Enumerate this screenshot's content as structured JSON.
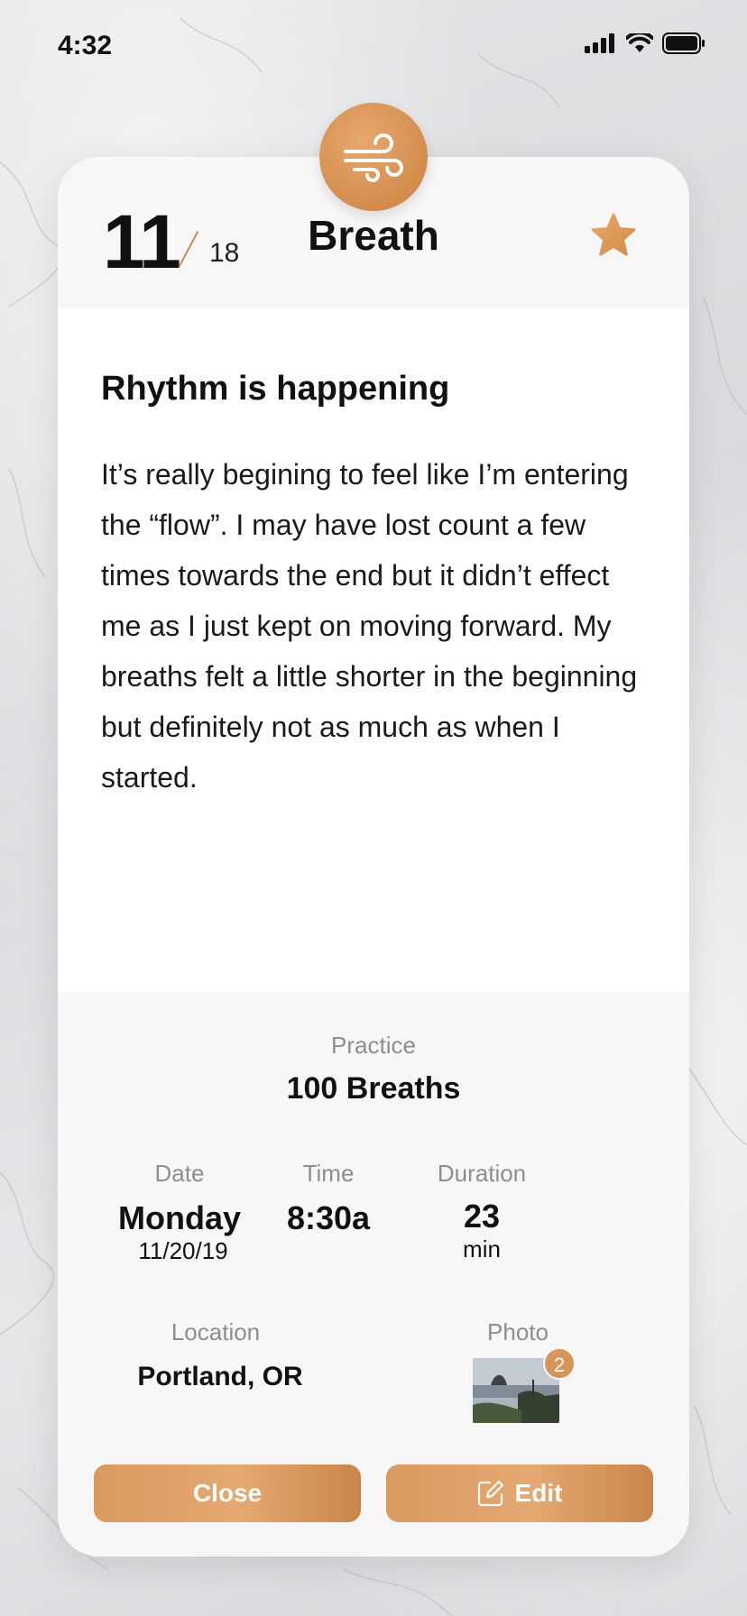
{
  "status_bar": {
    "time": "4:32"
  },
  "header": {
    "day": "11",
    "total": "18",
    "title": "Breath"
  },
  "entry": {
    "title": "Rhythm is happening",
    "body": "It’s really begining to feel like I’m entering the “flow”. I may have lost count a few times towards the end but it didn’t effect me as I just kept on moving forward. My breaths felt a little shorter in the beginning but definitely not as much as when I started."
  },
  "details": {
    "practice_label": "Practice",
    "practice_value": "100 Breaths",
    "date_label": "Date",
    "date_day": "Monday",
    "date_value": "11/20/19",
    "time_label": "Time",
    "time_value": "8:30a",
    "duration_label": "Duration",
    "duration_value": "23",
    "duration_unit": "min",
    "location_label": "Location",
    "location_value": "Portland, OR",
    "photo_label": "Photo",
    "photo_count": "2"
  },
  "buttons": {
    "close": "Close",
    "edit": "Edit"
  },
  "colors": {
    "accent": "#d99a5e",
    "card_gray": "#f7f7f7"
  },
  "icons": {
    "category": "wind-icon",
    "favorite": "star-icon",
    "edit": "edit-icon",
    "signal": "cellular-signal-icon",
    "wifi": "wifi-icon",
    "battery": "battery-icon"
  }
}
